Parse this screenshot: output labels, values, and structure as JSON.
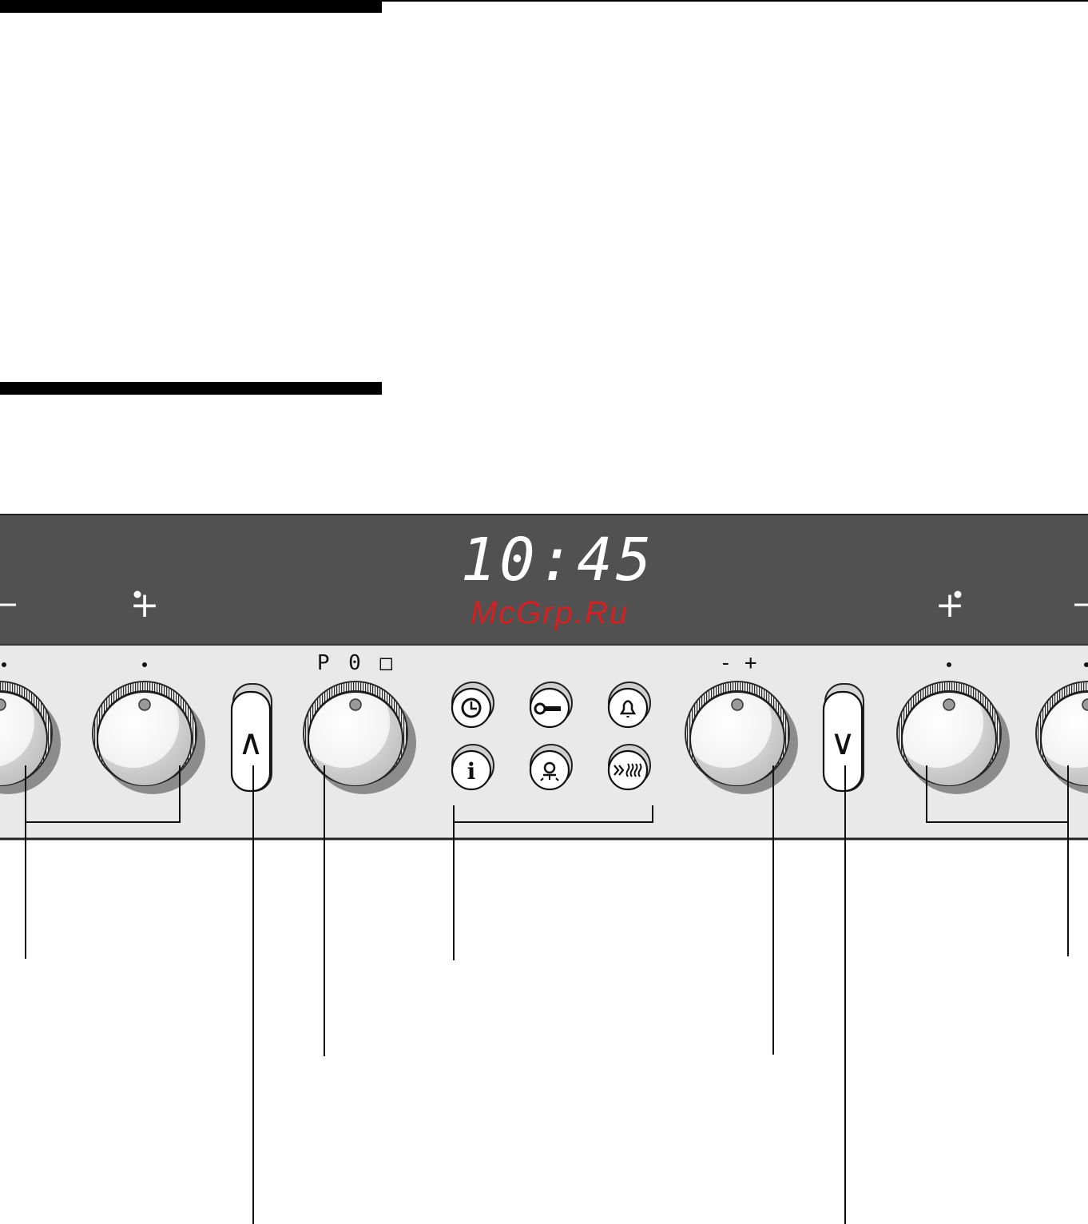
{
  "display": {
    "time": "10:45",
    "watermark": "McGrp.Ru",
    "watermark_color": "#d42020",
    "time_color": "#ffffff",
    "panel_dark": "#515151",
    "panel_light": "#e9e9e9"
  },
  "labels": {
    "program_selector": "P 0 □",
    "temperature_selector": "-  +",
    "cooktop_plus_left": "+",
    "cooktop_plus_right": "+"
  },
  "buttons": {
    "up": "∧",
    "down": "∨",
    "info": "i"
  },
  "icons": [
    "clock-icon",
    "key-lock-icon",
    "bell-timer-icon",
    "info-icon",
    "oven-light-icon",
    "rapid-heat-icon"
  ]
}
